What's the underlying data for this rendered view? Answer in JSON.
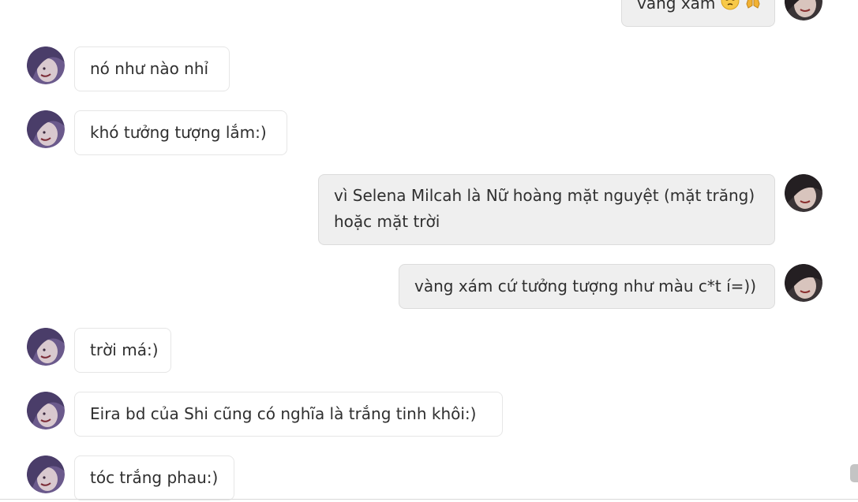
{
  "messages": [
    {
      "id": "m0",
      "side": "out",
      "text": "vàng xám"
    },
    {
      "id": "m1",
      "side": "in",
      "text": "nó như nào nhỉ"
    },
    {
      "id": "m2",
      "side": "in",
      "text": "khó tưởng tượng lắm:)"
    },
    {
      "id": "m3",
      "side": "out",
      "text": "vì Selena Milcah là Nữ hoàng mặt nguyệt (mặt trăng) hoặc mặt trời"
    },
    {
      "id": "m4",
      "side": "out",
      "text": "vàng xám cứ tưởng tượng như màu c*t í=))"
    },
    {
      "id": "m5",
      "side": "in",
      "text": "trời má:)"
    },
    {
      "id": "m6",
      "side": "in",
      "text": "Eira bd của Shi cũng có nghĩa là trắng tinh khôi:)"
    },
    {
      "id": "m7",
      "side": "in",
      "text": "tóc trắng phau:)"
    }
  ],
  "emojis": [
    "pensive-face-emoji",
    "praying-hands-emoji"
  ],
  "colors": {
    "incoming_bubble": "#ffffff",
    "outgoing_bubble": "#efefef",
    "text": "#2f2f2f",
    "avatar_in": "#6b5a8c",
    "avatar_out": "#3a3436"
  }
}
